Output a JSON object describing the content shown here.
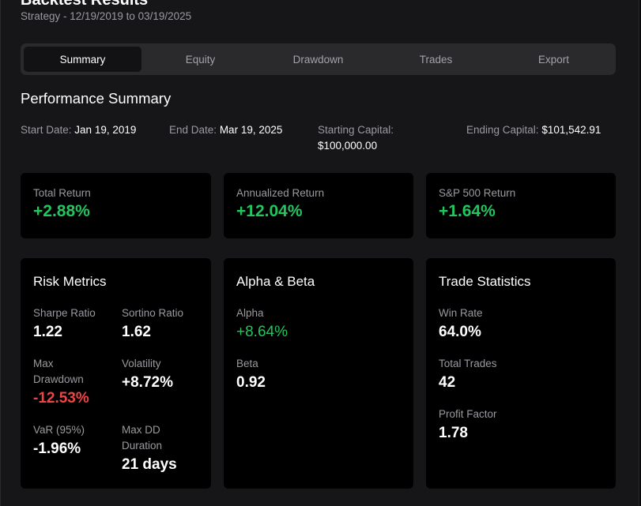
{
  "header": {
    "title": "Backtest Results",
    "subtitle": "Strategy - 12/19/2019 to 03/19/2025"
  },
  "tabs": [
    {
      "label": "Summary",
      "active": true
    },
    {
      "label": "Equity",
      "active": false
    },
    {
      "label": "Drawdown",
      "active": false
    },
    {
      "label": "Trades",
      "active": false
    },
    {
      "label": "Export",
      "active": false
    }
  ],
  "performance": {
    "title": "Performance Summary",
    "start_date_label": "Start Date:",
    "start_date": "Jan 19, 2019",
    "end_date_label": "End Date:",
    "end_date": "Mar 19, 2025",
    "starting_capital_label": "Starting Capital:",
    "starting_capital": "$100,000.00",
    "ending_capital_label": "Ending Capital:",
    "ending_capital": "$101,542.91"
  },
  "returns": {
    "total_label": "Total Return",
    "total_value": "+2.88%",
    "annualized_label": "Annualized Return",
    "annualized_value": "+12.04%",
    "sp500_label": "S&P 500 Return",
    "sp500_value": "+1.64%"
  },
  "risk": {
    "title": "Risk Metrics",
    "sharpe_label": "Sharpe Ratio",
    "sharpe_value": "1.22",
    "sortino_label": "Sortino Ratio",
    "sortino_value": "1.62",
    "maxdd_label": "Max Drawdown",
    "maxdd_value": "-12.53%",
    "volatility_label": "Volatility",
    "volatility_value": "+8.72%",
    "var_label": "VaR (95%)",
    "var_value": "-1.96%",
    "dd_duration_label": "Max DD Duration",
    "dd_duration_value": "21 days"
  },
  "alpha_beta": {
    "title": "Alpha & Beta",
    "alpha_label": "Alpha",
    "alpha_value": "+8.64%",
    "beta_label": "Beta",
    "beta_value": "0.92"
  },
  "trade_stats": {
    "title": "Trade Statistics",
    "win_rate_label": "Win Rate",
    "win_rate_value": "64.0%",
    "total_trades_label": "Total Trades",
    "total_trades_value": "42",
    "profit_factor_label": "Profit Factor",
    "profit_factor_value": "1.78"
  },
  "colors": {
    "positive": "#22c55e",
    "negative": "#ef4444",
    "card_bg": "#000000",
    "panel_bg": "#161618"
  }
}
